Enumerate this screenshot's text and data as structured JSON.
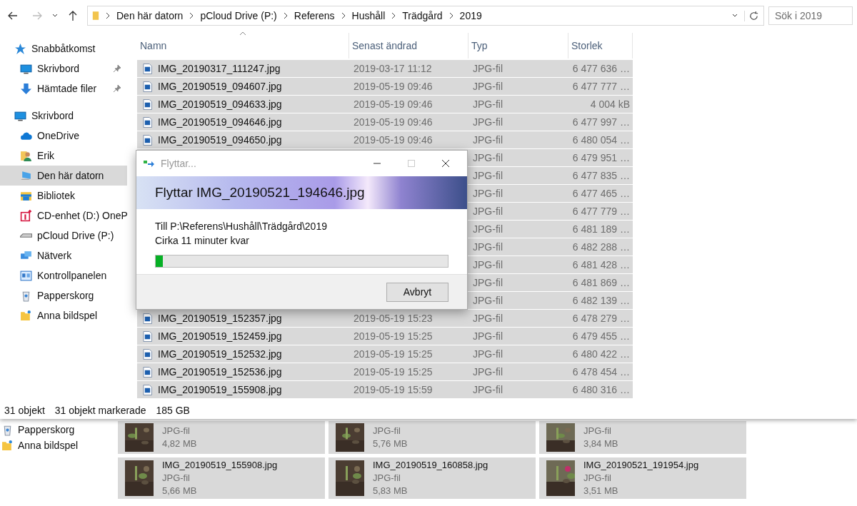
{
  "explorer": {
    "breadcrumbs": [
      "Den här datorn",
      "pCloud Drive (P:)",
      "Referens",
      "Hushåll",
      "Trädgård",
      "2019"
    ],
    "search": {
      "placeholder": "Sök i 2019"
    },
    "sidebar": [
      {
        "label": "Snabbåtkomst",
        "kind": "star",
        "selected": false,
        "children": [
          {
            "label": "Skrivbord",
            "kind": "desktop",
            "selected": false,
            "pinned": true
          },
          {
            "label": "Hämtade filer",
            "kind": "download",
            "selected": false,
            "pinned": true
          }
        ]
      },
      {
        "label": "Skrivbord",
        "kind": "desktop",
        "selected": false,
        "children": [
          {
            "label": "OneDrive",
            "kind": "cloud",
            "selected": false
          },
          {
            "label": "Erik",
            "kind": "user",
            "selected": false
          },
          {
            "label": "Den här datorn",
            "kind": "computer",
            "selected": true
          },
          {
            "label": "Bibliotek",
            "kind": "library",
            "selected": false
          },
          {
            "label": "CD-enhet (D:) OneP",
            "kind": "cd",
            "selected": false
          },
          {
            "label": "pCloud Drive (P:)",
            "kind": "drive",
            "selected": false
          },
          {
            "label": "Nätverk",
            "kind": "network",
            "selected": false
          },
          {
            "label": "Kontrollpanelen",
            "kind": "panel",
            "selected": false
          },
          {
            "label": "Papperskorg",
            "kind": "bin",
            "selected": false
          },
          {
            "label": "Anna bildspel",
            "kind": "folder",
            "selected": false
          }
        ]
      }
    ],
    "columns": [
      "Namn",
      "Senast ändrad",
      "Typ",
      "Storlek"
    ],
    "rows": [
      {
        "name": "IMG_20190317_111247.jpg",
        "date": "2019-03-17 11:12",
        "type": "JPG-fil",
        "size": "6 477 636 …",
        "selected": true
      },
      {
        "name": "IMG_20190519_094607.jpg",
        "date": "2019-05-19 09:46",
        "type": "JPG-fil",
        "size": "6 477 777 …",
        "selected": true
      },
      {
        "name": "IMG_20190519_094633.jpg",
        "date": "2019-05-19 09:46",
        "type": "JPG-fil",
        "size": "4 004 kB",
        "selected": true
      },
      {
        "name": "IMG_20190519_094646.jpg",
        "date": "2019-05-19 09:46",
        "type": "JPG-fil",
        "size": "6 477 997 …",
        "selected": true
      },
      {
        "name": "IMG_20190519_094650.jpg",
        "date": "2019-05-19 09:46",
        "type": "JPG-fil",
        "size": "6 480 054 …",
        "selected": true
      },
      {
        "type": "JPG-fil",
        "size": "6 479 951 …",
        "selected": true
      },
      {
        "type": "JPG-fil",
        "size": "6 477 835 …",
        "selected": true
      },
      {
        "type": "JPG-fil",
        "size": "6 477 465 …",
        "selected": true
      },
      {
        "type": "JPG-fil",
        "size": "6 477 779 …",
        "selected": true
      },
      {
        "type": "JPG-fil",
        "size": "6 481 189 …",
        "selected": true
      },
      {
        "type": "JPG-fil",
        "size": "6 482 288 …",
        "selected": true
      },
      {
        "type": "JPG-fil",
        "size": "6 481 428 …",
        "selected": true
      },
      {
        "type": "JPG-fil",
        "size": "6 481 869 …",
        "selected": true
      },
      {
        "type": "JPG-fil",
        "size": "6 482 139 …",
        "selected": true
      },
      {
        "name": "IMG_20190519_152357.jpg",
        "date": "2019-05-19 15:23",
        "type": "JPG-fil",
        "size": "6 478 279 …",
        "selected": true
      },
      {
        "name": "IMG_20190519_152459.jpg",
        "date": "2019-05-19 15:25",
        "type": "JPG-fil",
        "size": "6 479 455 …",
        "selected": true
      },
      {
        "name": "IMG_20190519_152532.jpg",
        "date": "2019-05-19 15:25",
        "type": "JPG-fil",
        "size": "6 480 422 …",
        "selected": true
      },
      {
        "name": "IMG_20190519_152536.jpg",
        "date": "2019-05-19 15:25",
        "type": "JPG-fil",
        "size": "6 478 454 …",
        "selected": true
      },
      {
        "name": "IMG_20190519_155908.jpg",
        "date": "2019-05-19 15:59",
        "type": "JPG-fil",
        "size": "6 480 316 …",
        "selected": true
      }
    ],
    "status_bar": {
      "count": "31 objekt",
      "selection": "31 objekt markerade",
      "size": "185 GB"
    }
  },
  "dialog": {
    "title": "Flyttar...",
    "heading": "Flyttar IMG_20190521_194646.jpg",
    "destination": "Till P:\\Referens\\Hushåll\\Trädgård\\2019",
    "remaining": "Cirka 11 minuter kvar",
    "progress": {
      "level": 0.025
    },
    "buttons": [
      "Avbryt"
    ]
  },
  "background_window": {
    "sidebar": [
      {
        "label": "Papperskorg",
        "kind": "bin"
      },
      {
        "label": "Anna bildspel",
        "kind": "folder"
      }
    ],
    "tiles": [
      {
        "type": "JPG-fil",
        "size": "4,82 MB",
        "selected": true
      },
      {
        "type": "JPG-fil",
        "size": "5,76 MB",
        "selected": true
      },
      {
        "type": "JPG-fil",
        "size": "3,84 MB",
        "selected": true
      },
      {
        "name": "IMG_20190519_155908.jpg",
        "type": "JPG-fil",
        "size": "5,66 MB",
        "selected": true
      },
      {
        "name": "IMG_20190519_160858.jpg",
        "type": "JPG-fil",
        "size": "5,83 MB",
        "selected": true
      },
      {
        "name": "IMG_20190521_191954.jpg",
        "type": "JPG-fil",
        "size": "3,51 MB",
        "selected": true
      }
    ]
  }
}
